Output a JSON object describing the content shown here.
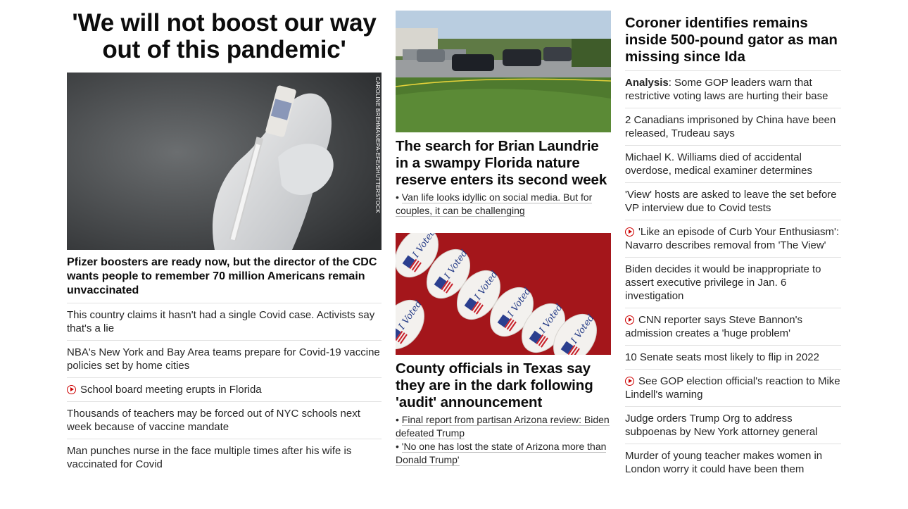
{
  "col1": {
    "headline": "'We will not boost our way out of this pandemic'",
    "image_credit": "CAROLINE BREHMAN/EPA-EFE/SHUTTERSTOCK",
    "lead_story": "Pfizer boosters are ready now, but the director of the CDC wants people to remember 70 million Americans remain unvaccinated",
    "items": [
      {
        "text": "This country claims it hasn't had a single Covid case. Activists say that's a lie",
        "video": false
      },
      {
        "text": "NBA's New York and Bay Area teams prepare for Covid-19 vaccine policies set by home cities",
        "video": false
      },
      {
        "text": "School board meeting erupts in Florida",
        "video": true
      },
      {
        "text": "Thousands of teachers may be forced out of NYC schools next week because of vaccine mandate",
        "video": false
      },
      {
        "text": "Man punches nurse in the face multiple times after his wife is vaccinated for Covid",
        "video": false
      }
    ]
  },
  "col2": {
    "story1": {
      "headline": "The search for Brian Laundrie in a swampy Florida nature reserve enters its second week",
      "bullets": [
        "Van life looks idyllic on social media. But for couples, it can be challenging"
      ]
    },
    "story2": {
      "headline": "County officials in Texas say they are in the dark following 'audit' announcement",
      "bullets": [
        "Final report from partisan Arizona review: Biden defeated Trump",
        "'No one has lost the state of Arizona more than Donald Trump'"
      ]
    },
    "sticker_text": "I Voted"
  },
  "col3": {
    "headline": "Coroner identifies remains inside 500-pound gator as man missing since Ida",
    "items": [
      {
        "prefix": "Analysis",
        "text": ": Some GOP leaders warn that restrictive voting laws are hurting their base",
        "video": false
      },
      {
        "prefix": "",
        "text": "2 Canadians imprisoned by China have been released, Trudeau says",
        "video": false
      },
      {
        "prefix": "",
        "text": "Michael K. Williams died of accidental overdose, medical examiner determines",
        "video": false
      },
      {
        "prefix": "",
        "text": "'View' hosts are asked to leave the set before VP interview due to Covid tests",
        "video": false
      },
      {
        "prefix": "",
        "text": "'Like an episode of Curb Your Enthusiasm': Navarro describes removal from 'The View'",
        "video": true
      },
      {
        "prefix": "",
        "text": "Biden decides it would be inappropriate to assert executive privilege in Jan. 6 investigation",
        "video": false
      },
      {
        "prefix": "",
        "text": "CNN reporter says Steve Bannon's admission creates a 'huge problem'",
        "video": true
      },
      {
        "prefix": "",
        "text": "10 Senate seats most likely to flip in 2022",
        "video": false
      },
      {
        "prefix": "",
        "text": "See GOP election official's reaction to Mike Lindell's warning",
        "video": true
      },
      {
        "prefix": "",
        "text": "Judge orders Trump Org to address subpoenas by New York attorney general",
        "video": false
      },
      {
        "prefix": "",
        "text": "Murder of young teacher makes women in London worry it could have been them",
        "video": false
      }
    ]
  },
  "colors": {
    "accent_red": "#cc0000",
    "divider": "#e1e1e1"
  }
}
